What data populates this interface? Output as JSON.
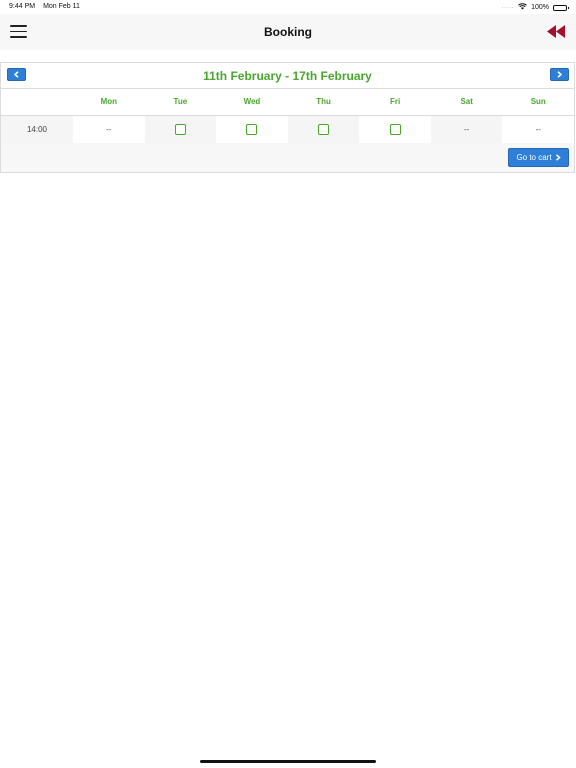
{
  "status_bar": {
    "time": "9:44 PM",
    "date": "Mon Feb 11",
    "signal_dots": "·····",
    "battery": "100%"
  },
  "nav": {
    "title": "Booking"
  },
  "booking": {
    "week_title": "11th February - 17th February",
    "days": [
      "Mon",
      "Tue",
      "Wed",
      "Thu",
      "Fri",
      "Sat",
      "Sun"
    ],
    "slots": [
      {
        "time": "14:00",
        "cells": [
          {
            "type": "text",
            "value": "--"
          },
          {
            "type": "checkbox"
          },
          {
            "type": "checkbox"
          },
          {
            "type": "checkbox"
          },
          {
            "type": "checkbox"
          },
          {
            "type": "text",
            "value": "--"
          },
          {
            "type": "text",
            "value": "--"
          }
        ]
      }
    ],
    "cart_button": "Go to cart"
  },
  "colors": {
    "accent_green": "#4aa62f",
    "button_blue": "#2d7fd8",
    "back_red": "#a5102a"
  }
}
